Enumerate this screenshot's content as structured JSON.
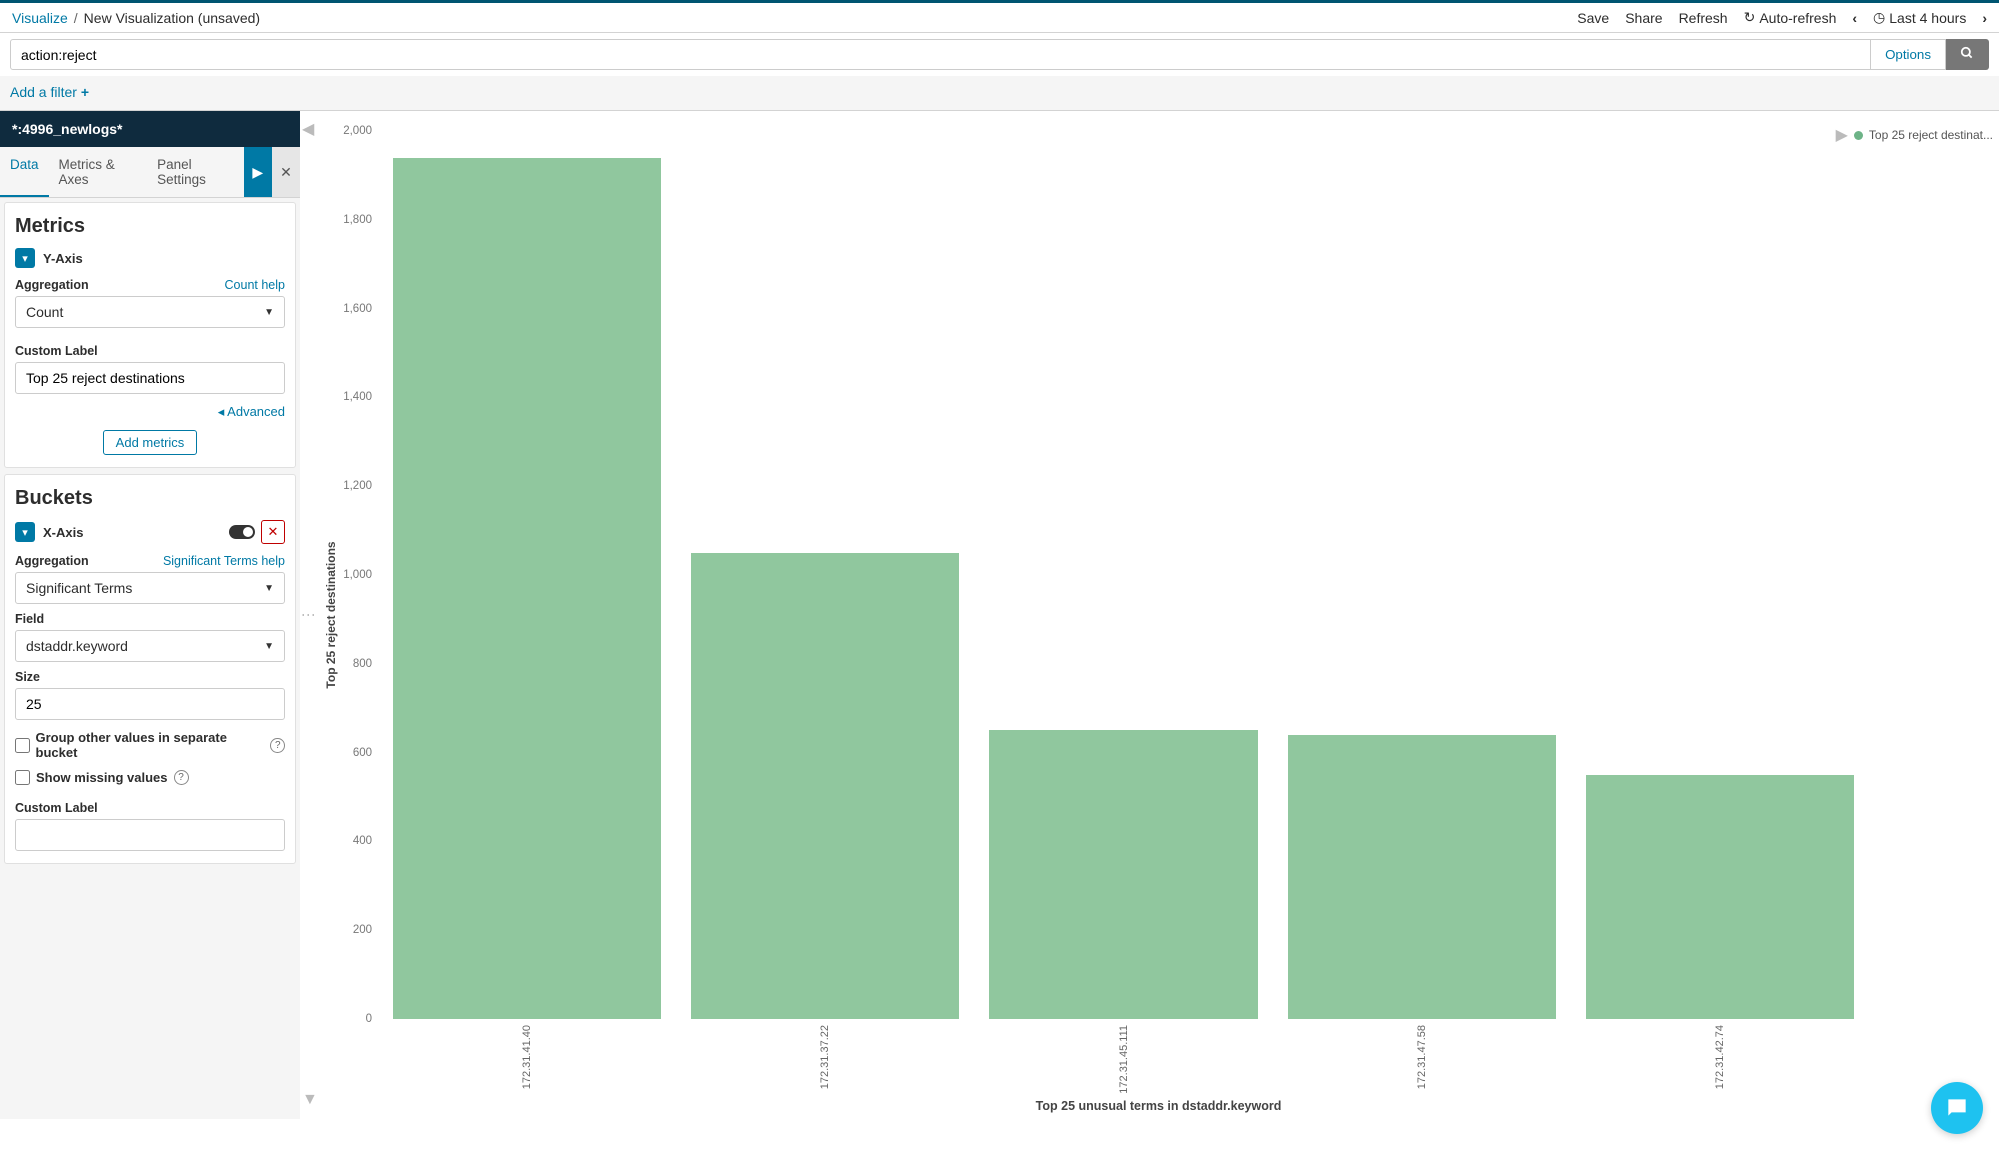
{
  "breadcrumb": {
    "root": "Visualize",
    "current": "New Visualization (unsaved)"
  },
  "top_actions": {
    "save": "Save",
    "share": "Share",
    "refresh": "Refresh",
    "auto_refresh": "Auto-refresh",
    "time_range": "Last 4 hours"
  },
  "search": {
    "query": "action:reject",
    "options_label": "Options"
  },
  "filter_bar": {
    "add_filter": "Add a filter"
  },
  "index_pattern": "*:4996_newlogs*",
  "tabs": {
    "data": "Data",
    "metrics_axes": "Metrics & Axes",
    "panel_settings": "Panel Settings"
  },
  "metrics": {
    "title": "Metrics",
    "axis_label": "Y-Axis",
    "agg_label": "Aggregation",
    "agg_help": "Count help",
    "agg_value": "Count",
    "custom_label_label": "Custom Label",
    "custom_label_value": "Top 25 reject destinations",
    "advanced": "Advanced",
    "add_metrics": "Add metrics"
  },
  "buckets": {
    "title": "Buckets",
    "axis_label": "X-Axis",
    "agg_label": "Aggregation",
    "agg_help": "Significant Terms help",
    "agg_value": "Significant Terms",
    "field_label": "Field",
    "field_value": "dstaddr.keyword",
    "size_label": "Size",
    "size_value": "25",
    "group_other": "Group other values in separate bucket",
    "show_missing": "Show missing values",
    "custom_label_label": "Custom Label",
    "custom_label_value": ""
  },
  "legend": {
    "series_label": "Top 25 reject destinat..."
  },
  "chart_data": {
    "type": "bar",
    "title": "",
    "xlabel": "Top 25 unusual terms in dstaddr.keyword",
    "ylabel": "Top 25 reject destinations",
    "ylim": [
      0,
      2000
    ],
    "y_ticks": [
      0,
      200,
      400,
      600,
      800,
      1000,
      1200,
      1400,
      1600,
      1800,
      2000
    ],
    "categories": [
      "172.31.41.40",
      "172.31.37.22",
      "172.31.45.111",
      "172.31.47.58",
      "172.31.42.74"
    ],
    "values": [
      1940,
      1050,
      650,
      640,
      550
    ],
    "series_color": "#90c79e"
  }
}
